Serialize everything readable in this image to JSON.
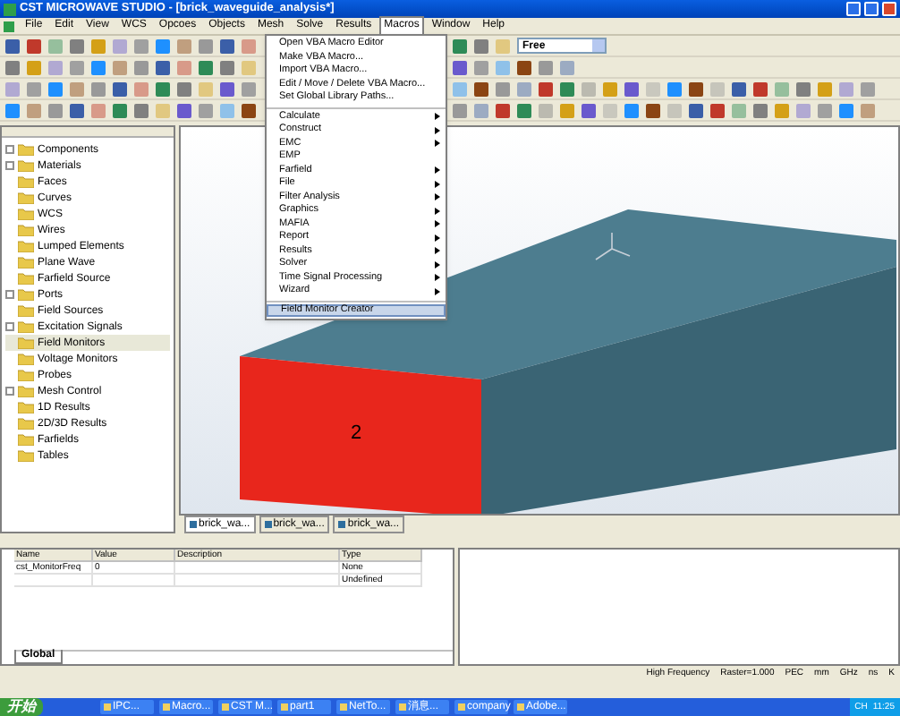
{
  "window": {
    "title": "CST MICROWAVE STUDIO - [brick_waveguide_analysis*]"
  },
  "menu_bar": [
    {
      "label": "File",
      "selected": false
    },
    {
      "label": "Edit",
      "selected": false
    },
    {
      "label": "View",
      "selected": false
    },
    {
      "label": "WCS",
      "selected": false
    },
    {
      "label": "Opcoes",
      "selected": false
    },
    {
      "label": "Objects",
      "selected": false
    },
    {
      "label": "Mesh",
      "selected": false
    },
    {
      "label": "Solve",
      "selected": false
    },
    {
      "label": "Results",
      "selected": false
    },
    {
      "label": "Macros",
      "selected": true
    },
    {
      "label": "Window",
      "selected": false
    },
    {
      "label": "Help",
      "selected": false
    }
  ],
  "macros_menu": [
    {
      "label": "Open VBA Macro Editor",
      "submenu": false,
      "selected": false,
      "separator_after": false
    },
    {
      "label": "Make VBA Macro...",
      "submenu": false,
      "selected": false,
      "separator_after": false
    },
    {
      "label": "Import VBA Macro...",
      "submenu": false,
      "selected": false,
      "separator_after": false
    },
    {
      "label": "Edit / Move / Delete VBA Macro...",
      "submenu": false,
      "selected": false,
      "separator_after": false
    },
    {
      "label": "Set Global Library Paths...",
      "submenu": false,
      "selected": false,
      "separator_after": true
    },
    {
      "label": "Calculate",
      "submenu": true,
      "selected": false,
      "separator_after": false
    },
    {
      "label": "Construct",
      "submenu": true,
      "selected": false,
      "separator_after": false
    },
    {
      "label": "EMC",
      "submenu": true,
      "selected": false,
      "separator_after": false
    },
    {
      "label": "EMP",
      "submenu": false,
      "selected": false,
      "separator_after": false
    },
    {
      "label": "Farfield",
      "submenu": true,
      "selected": false,
      "separator_after": false
    },
    {
      "label": "File",
      "submenu": true,
      "selected": false,
      "separator_after": false
    },
    {
      "label": "Filter Analysis",
      "submenu": true,
      "selected": false,
      "separator_after": false
    },
    {
      "label": "Graphics",
      "submenu": true,
      "selected": false,
      "separator_after": false
    },
    {
      "label": "MAFIA",
      "submenu": true,
      "selected": false,
      "separator_after": false
    },
    {
      "label": "Report",
      "submenu": true,
      "selected": false,
      "separator_after": false
    },
    {
      "label": "Results",
      "submenu": true,
      "selected": false,
      "separator_after": false
    },
    {
      "label": "Solver",
      "submenu": true,
      "selected": false,
      "separator_after": false
    },
    {
      "label": "Time Signal Processing",
      "submenu": true,
      "selected": false,
      "separator_after": false
    },
    {
      "label": "Wizard",
      "submenu": true,
      "selected": false,
      "separator_after": true
    },
    {
      "label": "Field Monitor Creator",
      "submenu": false,
      "selected": true,
      "separator_after": false
    }
  ],
  "toolbar": {
    "dropdown": "Free"
  },
  "tree": [
    {
      "label": "Components",
      "expandable": true,
      "selected": false
    },
    {
      "label": "Materials",
      "expandable": true,
      "selected": false
    },
    {
      "label": "Faces",
      "expandable": false,
      "selected": false
    },
    {
      "label": "Curves",
      "expandable": false,
      "selected": false
    },
    {
      "label": "WCS",
      "expandable": false,
      "selected": false
    },
    {
      "label": "Wires",
      "expandable": false,
      "selected": false
    },
    {
      "label": "Lumped Elements",
      "expandable": false,
      "selected": false
    },
    {
      "label": "Plane Wave",
      "expandable": false,
      "selected": false
    },
    {
      "label": "Farfield Source",
      "expandable": false,
      "selected": false
    },
    {
      "label": "Ports",
      "expandable": true,
      "selected": false
    },
    {
      "label": "Field Sources",
      "expandable": false,
      "selected": false
    },
    {
      "label": "Excitation Signals",
      "expandable": true,
      "selected": false
    },
    {
      "label": "Field Monitors",
      "expandable": false,
      "selected": true
    },
    {
      "label": "Voltage Monitors",
      "expandable": false,
      "selected": false
    },
    {
      "label": "Probes",
      "expandable": false,
      "selected": false
    },
    {
      "label": "Mesh Control",
      "expandable": true,
      "selected": false
    },
    {
      "label": "1D Results",
      "expandable": false,
      "selected": false
    },
    {
      "label": "2D/3D Results",
      "expandable": false,
      "selected": false
    },
    {
      "label": "Farfields",
      "expandable": false,
      "selected": false
    },
    {
      "label": "Tables",
      "expandable": false,
      "selected": false
    }
  ],
  "view": {
    "port_label": "2"
  },
  "document_tabs": [
    {
      "label": "brick_wa...",
      "selected": true
    },
    {
      "label": "brick_wa...",
      "selected": false
    },
    {
      "label": "brick_wa...",
      "selected": false
    }
  ],
  "parameters": {
    "columns": [
      "Name",
      "Value",
      "Description",
      "Type"
    ],
    "rows": [
      [
        "cst_MonitorFreq",
        "0",
        "",
        "None"
      ],
      [
        "",
        "",
        "",
        "Undefined"
      ]
    ],
    "tab": "Global"
  },
  "status_bar": [
    "High Frequency",
    "Raster=1.000",
    "PEC",
    "mm",
    "GHz",
    "ns",
    "K"
  ],
  "taskbar": {
    "start": "开始",
    "items": [
      "IPC...",
      "Macro...",
      "CST M...",
      "part1",
      "NetTo...",
      "消息...",
      "company",
      "Adobe..."
    ],
    "language": "CH",
    "time": "11:25"
  }
}
